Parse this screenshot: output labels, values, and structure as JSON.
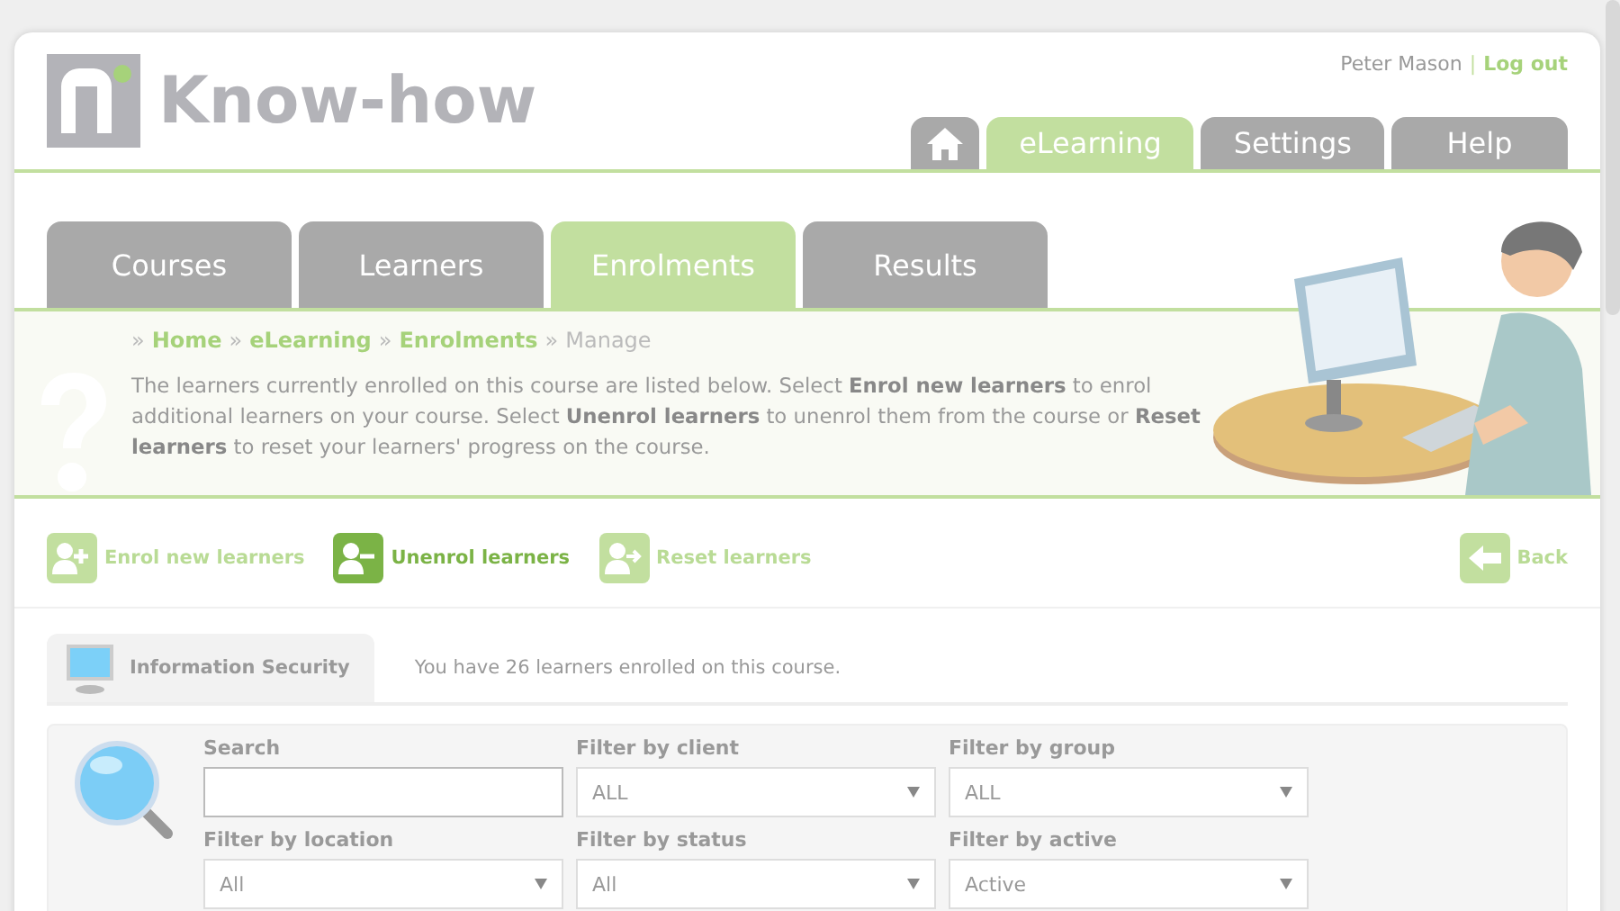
{
  "brand": {
    "name": "Know-how"
  },
  "user": {
    "name": "Peter Mason",
    "separator": "|",
    "logout": "Log out"
  },
  "nav_tabs": [
    {
      "kind": "home",
      "selected": false
    },
    {
      "kind": "text",
      "label": "eLearning",
      "selected": true
    },
    {
      "kind": "text",
      "label": "Settings",
      "selected": false
    },
    {
      "kind": "text",
      "label": "Help",
      "selected": false
    }
  ],
  "sub_tabs": [
    {
      "label": "Courses",
      "selected": false
    },
    {
      "label": "Learners",
      "selected": false
    },
    {
      "label": "Enrolments",
      "selected": true
    },
    {
      "label": "Results",
      "selected": false
    }
  ],
  "breadcrumb": [
    {
      "label": "Home",
      "link": true
    },
    {
      "label": "eLearning",
      "link": true
    },
    {
      "label": "Enrolments",
      "link": true
    },
    {
      "label": "Manage",
      "link": false
    }
  ],
  "breadcrumb_separator": "»",
  "intro": "The learners currently enrolled on this course are listed below. Select **Enrol new learners** to enrol additional learners on your course. Select **Unenrol learners** to unenrol them from the course or **Reset learners** to reset your learners' progress on the course.",
  "actions": [
    {
      "kind": "add",
      "label": "Enrol new learners",
      "active": false
    },
    {
      "kind": "remove",
      "label": "Unenrol learners",
      "active": true
    },
    {
      "kind": "reset",
      "label": "Reset learners",
      "active": false
    }
  ],
  "back": {
    "label": "Back"
  },
  "course": {
    "title": "Information Security",
    "summary": "You have 26 learners enrolled on this course."
  },
  "filters": [
    {
      "kind": "text",
      "label": "Search"
    },
    {
      "kind": "select",
      "label": "Filter by client",
      "value": "ALL"
    },
    {
      "kind": "select",
      "label": "Filter by group",
      "value": "ALL"
    },
    {
      "kind": "select",
      "label": "Filter by location",
      "value": "All"
    },
    {
      "kind": "select",
      "label": "Filter by status",
      "value": "All"
    },
    {
      "kind": "select",
      "label": "Filter by active",
      "value": "Active"
    }
  ]
}
